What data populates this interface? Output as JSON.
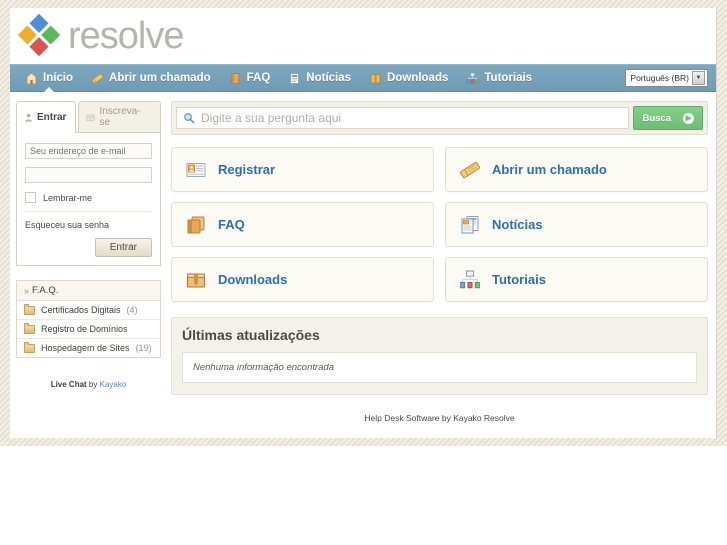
{
  "brand": {
    "name": "resolve",
    "logo_icon": "kayako-diamond-logo"
  },
  "nav": {
    "items": [
      {
        "label": "Início",
        "icon": "home-icon",
        "active": true
      },
      {
        "label": "Abrir um chamado",
        "icon": "ticket-icon",
        "active": false
      },
      {
        "label": "FAQ",
        "icon": "book-icon",
        "active": false
      },
      {
        "label": "Notícias",
        "icon": "newspaper-icon",
        "active": false
      },
      {
        "label": "Downloads",
        "icon": "box-icon",
        "active": false
      },
      {
        "label": "Tutoriais",
        "icon": "sitemap-icon",
        "active": false
      }
    ],
    "language": {
      "selected": "Português (BR)",
      "arrow_icon": "chevron-down-icon"
    }
  },
  "sidebar": {
    "login": {
      "tabs": [
        {
          "label": "Entrar",
          "icon": "user-icon",
          "active": true
        },
        {
          "label": "Inscreva-se",
          "icon": "envelope-icon",
          "active": false
        }
      ],
      "email_placeholder": "Seu endereço de e-mail",
      "email_value": "",
      "password_placeholder": "",
      "password_value": "",
      "remember_label": "Lembrar-me",
      "remember_checked": false,
      "forgot_label": "Esqueceu sua senha",
      "submit_label": "Entrar"
    },
    "faq": {
      "header": "F.A.Q.",
      "header_icon": "double-chevron-right-icon",
      "items": [
        {
          "label": "Certificados Digitais",
          "count": "(4)",
          "icon": "folder-icon"
        },
        {
          "label": "Registro de Domínios",
          "count": "",
          "icon": "folder-icon"
        },
        {
          "label": "Hospedagem de Sites",
          "count": "(19)",
          "icon": "folder-icon"
        }
      ]
    },
    "livechat": {
      "prefix": "Live Chat",
      "middle": " by ",
      "link": "Kayako"
    }
  },
  "search": {
    "icon": "search-icon",
    "placeholder": "Digite a sua pergunta aqui",
    "value": "",
    "button_label": "Busca",
    "button_icon": "go-arrow-icon"
  },
  "tiles": [
    {
      "label": "Registrar",
      "icon": "vcard-icon"
    },
    {
      "label": "Abrir um chamado",
      "icon": "ticket-icon"
    },
    {
      "label": "FAQ",
      "icon": "books-icon"
    },
    {
      "label": "Notícias",
      "icon": "newspaper-icon"
    },
    {
      "label": "Downloads",
      "icon": "package-icon"
    },
    {
      "label": "Tutoriais",
      "icon": "sitemap-icon"
    }
  ],
  "updates": {
    "title": "Últimas atualizações",
    "empty_message": "Nenhuma informação encontrada"
  },
  "footer": {
    "text": "Help Desk Software by Kayako Resolve"
  },
  "colors": {
    "nav_bar": "#6f9bb4",
    "link_blue": "#2f6fad",
    "search_green": "#6cbf74",
    "frame_stripe": "#e6e0d2",
    "panel_cream": "#f3f0e8"
  }
}
